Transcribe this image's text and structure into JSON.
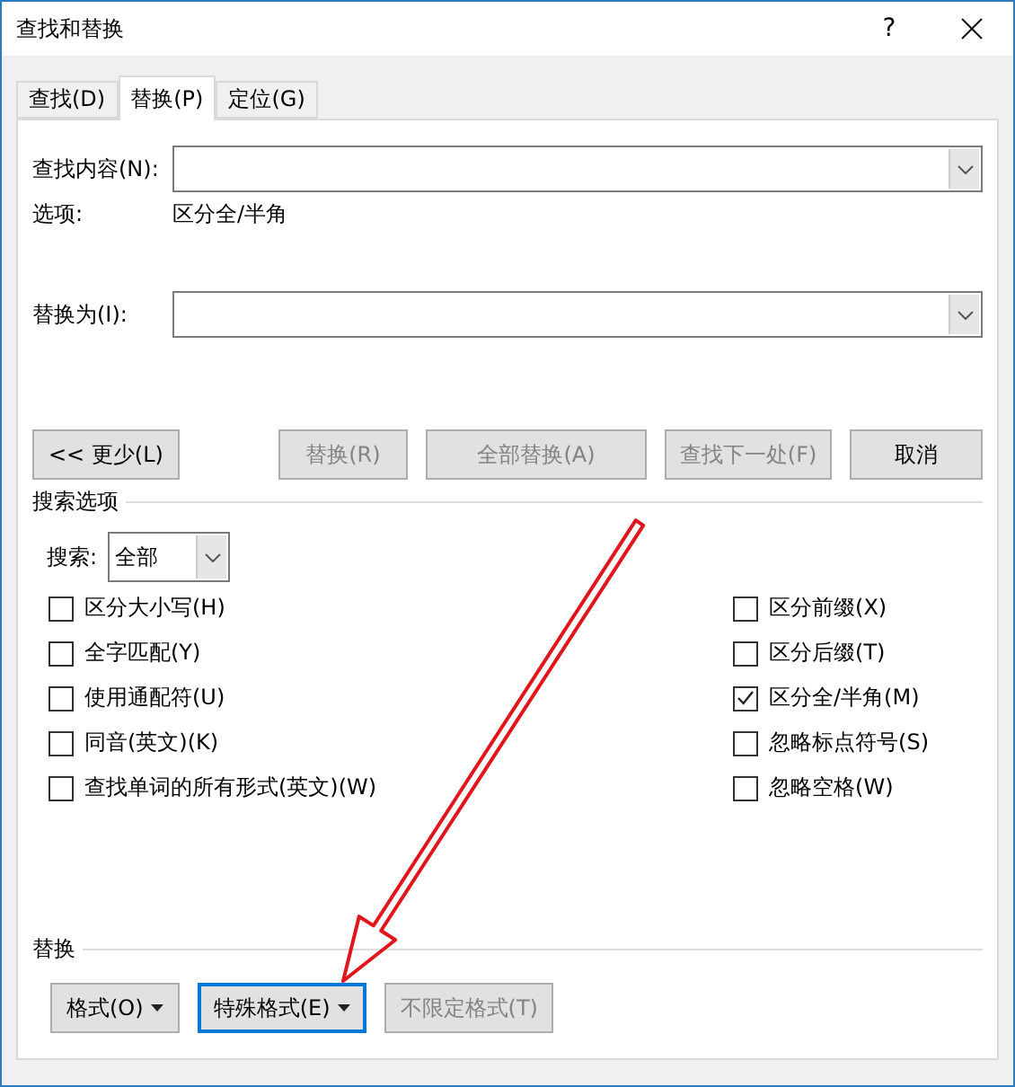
{
  "window": {
    "title": "查找和替换",
    "help": "?"
  },
  "tabs": [
    {
      "label": "查找(D)",
      "selected": false
    },
    {
      "label": "替换(P)",
      "selected": true
    },
    {
      "label": "定位(G)",
      "selected": false
    }
  ],
  "find": {
    "label": "查找内容(N):",
    "options_label": "选项:",
    "options_value": "区分全/半角"
  },
  "replace": {
    "label": "替换为(I):"
  },
  "actions": [
    {
      "label": "<< 更少(L)",
      "disabled": false
    },
    {
      "label": "替换(R)",
      "disabled": true
    },
    {
      "label": "全部替换(A)",
      "disabled": true
    },
    {
      "label": "查找下一处(F)",
      "disabled": true
    },
    {
      "label": "取消",
      "disabled": false
    }
  ],
  "search_options": {
    "heading": "搜索选项",
    "search_label": "搜索:",
    "search_value": "全部",
    "left": [
      {
        "label": "区分大小写(H)",
        "checked": false
      },
      {
        "label": "全字匹配(Y)",
        "checked": false
      },
      {
        "label": "使用通配符(U)",
        "checked": false
      },
      {
        "label": "同音(英文)(K)",
        "checked": false
      },
      {
        "label": "查找单词的所有形式(英文)(W)",
        "checked": false
      }
    ],
    "right": [
      {
        "label": "区分前缀(X)",
        "checked": false
      },
      {
        "label": "区分后缀(T)",
        "checked": false
      },
      {
        "label": "区分全/半角(M)",
        "checked": true
      },
      {
        "label": "忽略标点符号(S)",
        "checked": false
      },
      {
        "label": "忽略空格(W)",
        "checked": false
      }
    ]
  },
  "replace_section": {
    "heading": "替换",
    "buttons": [
      {
        "label": "格式(O)",
        "disabled": false,
        "focused": false,
        "dropdown": true
      },
      {
        "label": "特殊格式(E)",
        "disabled": false,
        "focused": true,
        "dropdown": true
      },
      {
        "label": "不限定格式(T)",
        "disabled": true,
        "focused": false,
        "dropdown": false
      }
    ]
  }
}
